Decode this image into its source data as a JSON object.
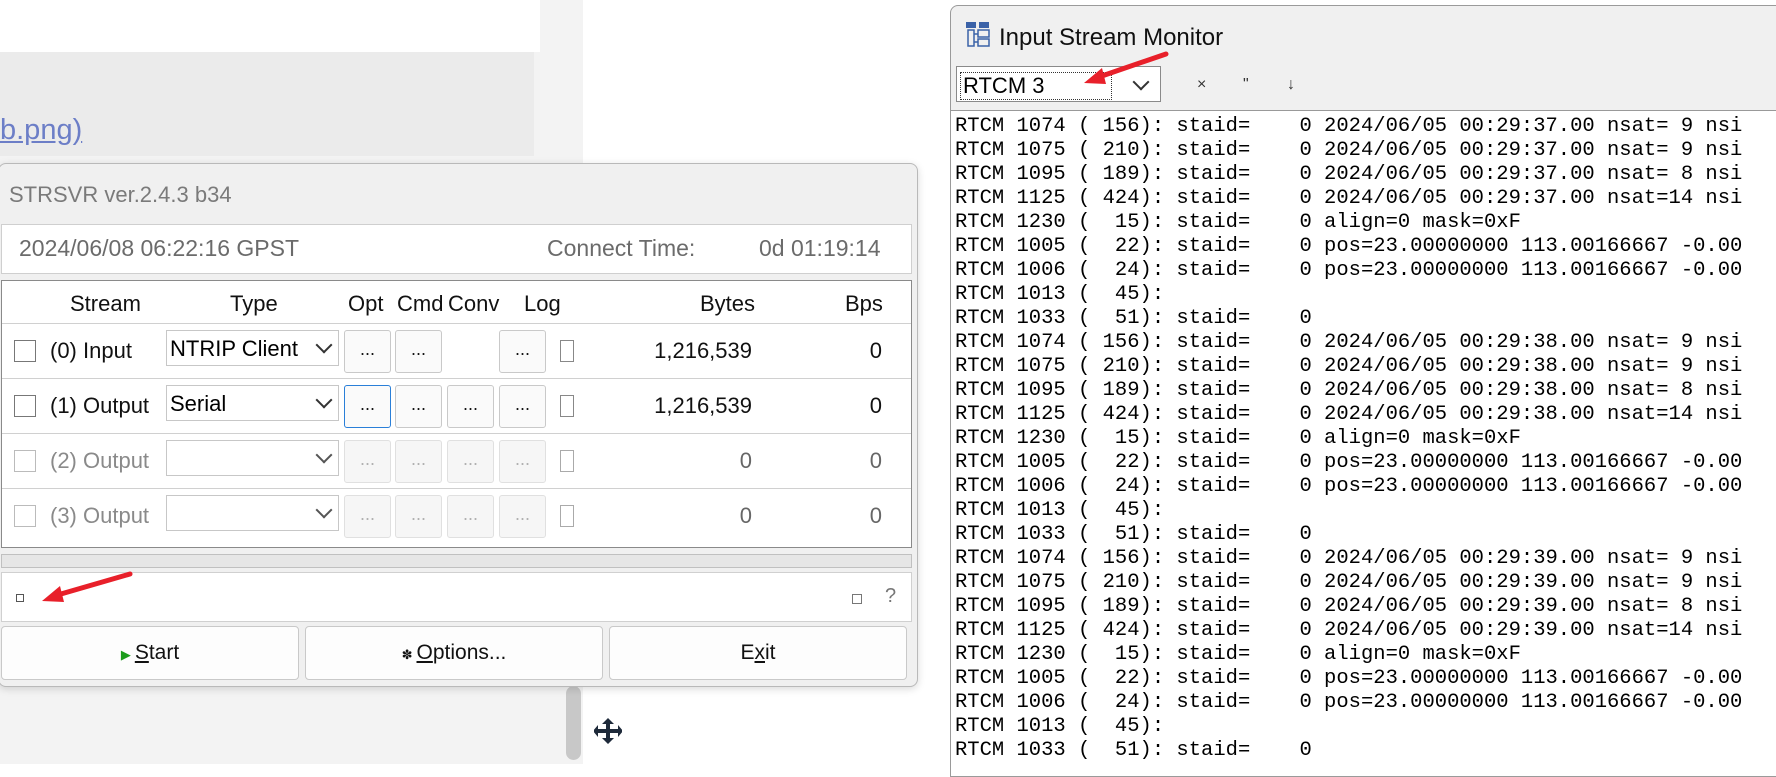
{
  "background": {
    "link_text": "b.png)"
  },
  "strsvr": {
    "title": "STRSVR ver.2.4.3 b34",
    "time": "2024/06/08 06:22:16 GPST",
    "connect_label": "Connect Time:",
    "connect_value": "0d 01:19:14",
    "headers": {
      "stream": "Stream",
      "type": "Type",
      "opt": "Opt",
      "cmd": "Cmd",
      "conv": "Conv",
      "log": "Log",
      "bytes": "Bytes",
      "bps": "Bps"
    },
    "rows": [
      {
        "label": "(0) Input",
        "type": "NTRIP Client",
        "bytes": "1,216,539",
        "bps": "0",
        "enabled": true
      },
      {
        "label": "(1) Output",
        "type": "Serial",
        "bytes": "1,216,539",
        "bps": "0",
        "enabled": true
      },
      {
        "label": "(2) Output",
        "type": "",
        "bytes": "0",
        "bps": "0",
        "enabled": false
      },
      {
        "label": "(3) Output",
        "type": "",
        "bytes": "0",
        "bps": "0",
        "enabled": false
      }
    ],
    "ellipsis": "...",
    "help_label": "?",
    "buttons": {
      "start_mark": "▶",
      "start_underline": "S",
      "start_rest": "tart",
      "options_mark": "✽",
      "options_underline": "O",
      "options_rest": "ptions...",
      "exit_pre": "E",
      "exit_underline": "x",
      "exit_rest": "it"
    }
  },
  "monitor": {
    "title": "Input Stream Monitor",
    "format_value": "RTCM 3",
    "toolbar": {
      "clear_icon": "×",
      "pause_icon": "\"",
      "down_icon": "↓"
    },
    "lines": [
      "RTCM 1074 ( 156): staid=    0 2024/06/05 00:29:37.00 nsat= 9 nsi",
      "RTCM 1075 ( 210): staid=    0 2024/06/05 00:29:37.00 nsat= 9 nsi",
      "RTCM 1095 ( 189): staid=    0 2024/06/05 00:29:37.00 nsat= 8 nsi",
      "RTCM 1125 ( 424): staid=    0 2024/06/05 00:29:37.00 nsat=14 nsi",
      "RTCM 1230 (  15): staid=    0 align=0 mask=0xF",
      "RTCM 1005 (  22): staid=    0 pos=23.00000000 113.00166667 -0.00",
      "RTCM 1006 (  24): staid=    0 pos=23.00000000 113.00166667 -0.00",
      "RTCM 1013 (  45):",
      "RTCM 1033 (  51): staid=    0",
      "RTCM 1074 ( 156): staid=    0 2024/06/05 00:29:38.00 nsat= 9 nsi",
      "RTCM 1075 ( 210): staid=    0 2024/06/05 00:29:38.00 nsat= 9 nsi",
      "RTCM 1095 ( 189): staid=    0 2024/06/05 00:29:38.00 nsat= 8 nsi",
      "RTCM 1125 ( 424): staid=    0 2024/06/05 00:29:38.00 nsat=14 nsi",
      "RTCM 1230 (  15): staid=    0 align=0 mask=0xF",
      "RTCM 1005 (  22): staid=    0 pos=23.00000000 113.00166667 -0.00",
      "RTCM 1006 (  24): staid=    0 pos=23.00000000 113.00166667 -0.00",
      "RTCM 1013 (  45):",
      "RTCM 1033 (  51): staid=    0",
      "RTCM 1074 ( 156): staid=    0 2024/06/05 00:29:39.00 nsat= 9 nsi",
      "RTCM 1075 ( 210): staid=    0 2024/06/05 00:29:39.00 nsat= 9 nsi",
      "RTCM 1095 ( 189): staid=    0 2024/06/05 00:29:39.00 nsat= 8 nsi",
      "RTCM 1125 ( 424): staid=    0 2024/06/05 00:29:39.00 nsat=14 nsi",
      "RTCM 1230 (  15): staid=    0 align=0 mask=0xF",
      "RTCM 1005 (  22): staid=    0 pos=23.00000000 113.00166667 -0.00",
      "RTCM 1006 (  24): staid=    0 pos=23.00000000 113.00166667 -0.00",
      "RTCM 1013 (  45):",
      "RTCM 1033 (  51): staid=    0"
    ]
  },
  "colors": {
    "annotation_arrow": "#e8202a",
    "focus_border": "#2a7fd8",
    "start_icon": "#1c9c1c"
  },
  "icons": {
    "app_icon": "stream-monitor-icon",
    "move_icon": "move-cross-icon"
  }
}
